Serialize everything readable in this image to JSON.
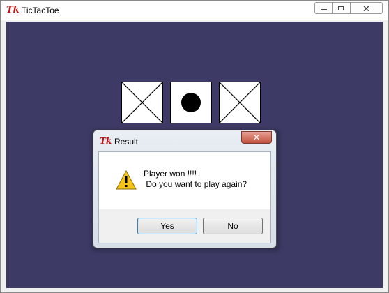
{
  "app": {
    "title": "TicTacToe",
    "logo_text": "Tk",
    "controls": {
      "minimize_icon": "minimize-icon",
      "maximize_icon": "maximize-icon",
      "close_icon": "close-icon",
      "close_glyph": "✕"
    }
  },
  "board": {
    "background": "#3d3a66",
    "visible_cells": [
      {
        "id": "cell-1",
        "mark": "X"
      },
      {
        "id": "cell-2",
        "mark": "O"
      },
      {
        "id": "cell-3",
        "mark": "X"
      }
    ]
  },
  "dialog": {
    "logo_text": "Tk",
    "title": "Result",
    "close_glyph": "✕",
    "icon": "warning-icon",
    "message_line1": "Player won !!!!",
    "message_line2": " Do you want to play again?",
    "yes_label": "Yes",
    "no_label": "No"
  }
}
